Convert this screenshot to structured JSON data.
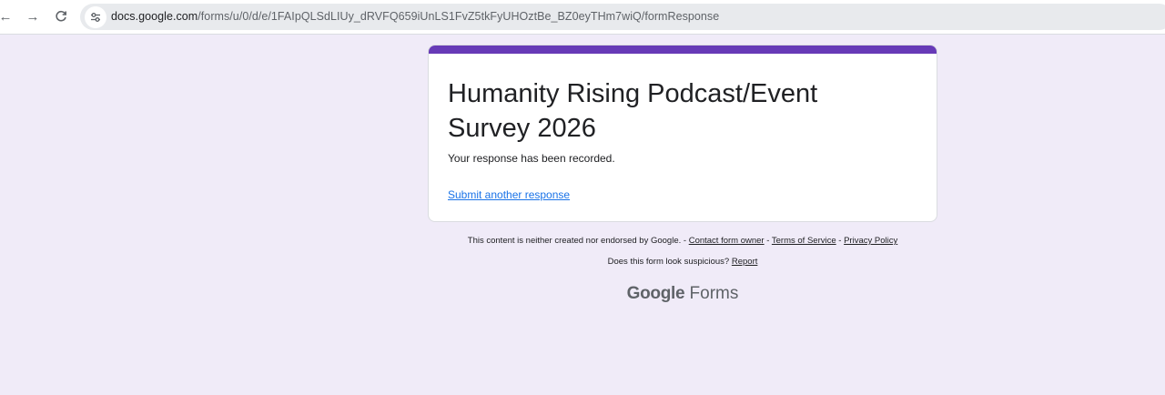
{
  "browser": {
    "back_icon": "←",
    "forward_icon": "→",
    "reload_icon": "C",
    "url_host": "docs.google.com",
    "url_path": "/forms/u/0/d/e/1FAIpQLSdLIUy_dRVFQ659iUnLS1FvZ5tkFyUHOztBe_BZ0eyTHm7wiQ/formResponse"
  },
  "form": {
    "accent_color": "#673ab7",
    "title": "Humanity Rising Podcast/Event Survey 2026",
    "confirmation": "Your response has been recorded.",
    "submit_another": "Submit another response"
  },
  "footer": {
    "disclaimer_text": "This content is neither created nor endorsed by Google. -",
    "sep1": "-",
    "sep2": "-",
    "contact_owner": "Contact form owner",
    "terms": "Terms of Service",
    "privacy": "Privacy Policy",
    "suspicious_text": "Does this form look suspicious?",
    "report": "Report",
    "brand_google": "Google",
    "brand_forms": "Forms"
  },
  "colors": {
    "page_background": "#f0ebf8",
    "link": "#1a73e8"
  }
}
